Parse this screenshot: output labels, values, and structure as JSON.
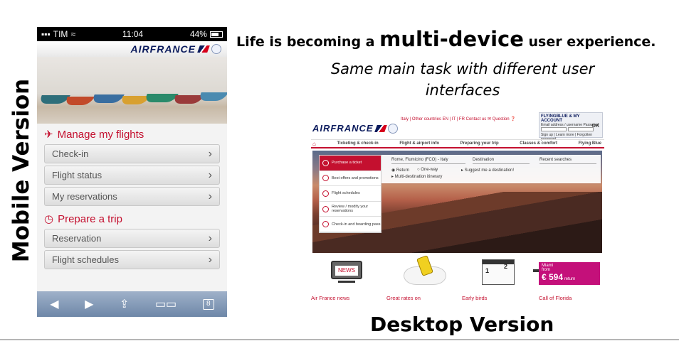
{
  "vertical_label": "Mobile Version",
  "headline": {
    "part1": "Life is becoming a ",
    "emphasis": "multi-device",
    "part2": " user experience."
  },
  "subhead": "Same main task with different user interfaces",
  "desktop_label": "Desktop Version",
  "mobile": {
    "status": {
      "carrier": "TIM",
      "time": "11:04",
      "battery": "44%"
    },
    "brand": "AIRFRANCE",
    "manage_title": "Manage my flights",
    "manage_items": [
      "Check-in",
      "Flight status",
      "My reservations"
    ],
    "prepare_title": "Prepare a trip",
    "prepare_items": [
      "Reservation",
      "Flight schedules"
    ],
    "toolbar": {
      "back": "◀",
      "forward": "▶",
      "share": "⇪",
      "bookmarks": "📖",
      "tabs": "8"
    }
  },
  "desktop": {
    "brand": "AIRFRANCE",
    "top_links": "Italy | Other countries    EN | IT | FR      Contact us ✉   Question ❓",
    "account": {
      "title": "FLYINGBLUE & MY ACCOUNT",
      "fields_label": "Email address / username   Password",
      "ok": "OK",
      "links": "Sign up | Learn more | Forgotten password"
    },
    "nav": [
      "Ticketing & check-in",
      "Flight & airport info",
      "Preparing your trip",
      "Classes & comfort",
      "Flying Blue"
    ],
    "menu": [
      {
        "label": "Purchase a ticket",
        "active": true
      },
      {
        "label": "Best offers and promotions",
        "active": false
      },
      {
        "label": "Flight schedules",
        "active": false
      },
      {
        "label": "Review / modify your reservations",
        "active": false
      },
      {
        "label": "Check-in and boarding pass",
        "active": false
      }
    ],
    "search": {
      "origin": "Rome, Fiumicino (FCO) - Italy",
      "destination": "Destination",
      "recent": "Recent searches",
      "return": "Return",
      "oneway": "One-way",
      "suggest": "▸ Suggest me a destination!",
      "multi": "▸ Multi-destination itinerary"
    },
    "tiles": [
      {
        "caption": "Air France news",
        "image_text": "NEWS"
      },
      {
        "caption": "Great rates on",
        "image_text": ""
      },
      {
        "caption": "Early birds",
        "image_text": ""
      },
      {
        "caption": "Call of Florida",
        "image_text": ""
      }
    ],
    "calendar_numbers": [
      "1",
      "2"
    ],
    "miami": {
      "city": "Miami",
      "from": "from",
      "price": "€ 594",
      "suffix": "return"
    }
  },
  "colors": {
    "brand_navy": "#0a1a5c",
    "brand_red": "#c4102f",
    "promo_magenta": "#c4107a",
    "ios_toolbar": "#7f95b4"
  }
}
